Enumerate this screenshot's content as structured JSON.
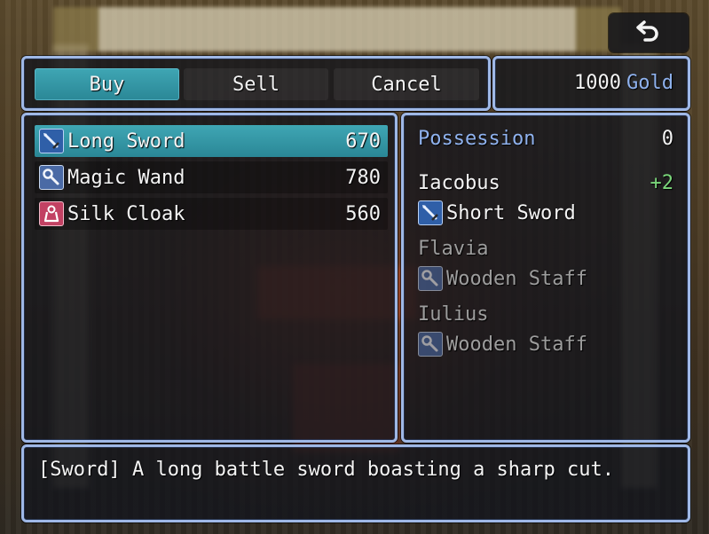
{
  "commands": [
    {
      "label": "Buy",
      "selected": true
    },
    {
      "label": "Sell",
      "selected": false
    },
    {
      "label": "Cancel",
      "selected": false
    }
  ],
  "gold": {
    "amount": "1000",
    "unit": "Gold"
  },
  "items": [
    {
      "name": "Long Sword",
      "price": "670",
      "icon": "sword-icon",
      "selected": true
    },
    {
      "name": "Magic Wand",
      "price": "780",
      "icon": "wand-icon",
      "selected": false
    },
    {
      "name": "Silk Cloak",
      "price": "560",
      "icon": "cloak-icon",
      "selected": false
    }
  ],
  "status": {
    "possession_label": "Possession",
    "possession_value": "0",
    "actors": [
      {
        "name": "Iacobus",
        "change": "+2",
        "equip": "Short Sword",
        "equip_icon": "sword-icon",
        "enabled": true
      },
      {
        "name": "Flavia",
        "change": "",
        "equip": "Wooden Staff",
        "equip_icon": "wand-icon",
        "enabled": false
      },
      {
        "name": "Iulius",
        "change": "",
        "equip": "Wooden Staff",
        "equip_icon": "wand-icon",
        "enabled": false
      }
    ]
  },
  "help": {
    "text": "[Sword] A long battle sword boasting a sharp cut."
  },
  "colors": {
    "window_border": "#9fb8e6",
    "selection": "#3fa6b4",
    "system_blue": "#8fb2ee",
    "power_up_green": "#7ad67a",
    "disabled_grey": "#9d9d9d"
  }
}
